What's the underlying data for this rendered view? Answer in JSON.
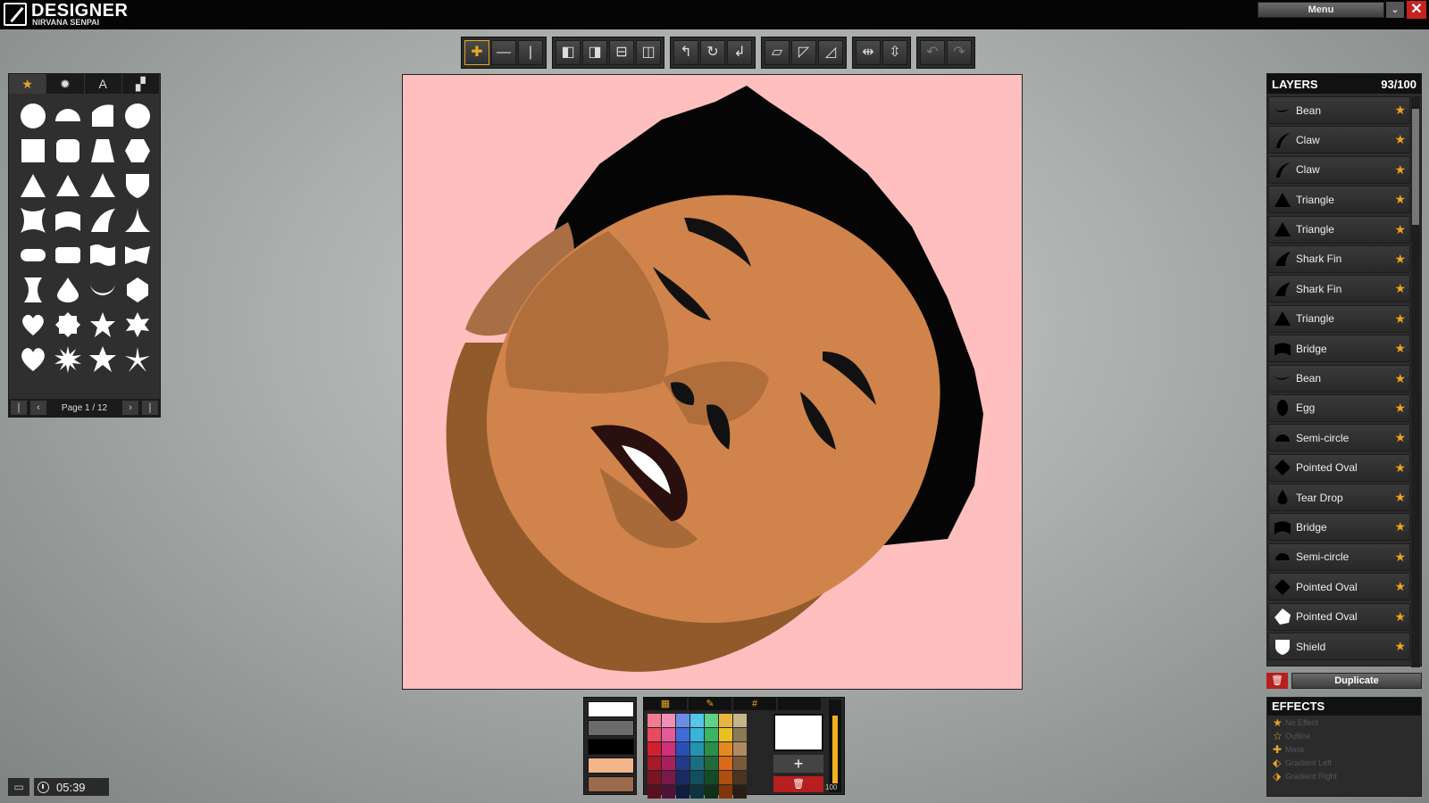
{
  "app": {
    "title": "DESIGNER",
    "subtitle": "NIRVANA SENPAI"
  },
  "topbar": {
    "menu_label": "Menu",
    "arrow": "⌄",
    "close": "✕"
  },
  "toolbar": {
    "groups": [
      [
        "move-icon",
        "minus-icon",
        "vertical-icon"
      ],
      [
        "layer-front-icon",
        "layer-back-icon",
        "align-h-icon",
        "align-v-icon"
      ],
      [
        "rotate-ccw-icon",
        "rotate-icon",
        "rotate-cw-icon"
      ],
      [
        "skew-icon",
        "stretch-h-icon",
        "stretch-v-icon"
      ],
      [
        "flip-h-icon",
        "flip-v-icon"
      ],
      [
        "undo-icon",
        "redo-icon"
      ]
    ]
  },
  "shape_panel": {
    "tabs": [
      "★",
      "✹",
      "A",
      "▞"
    ],
    "page_label": "Page 1 / 12",
    "shapes": [
      "circle",
      "semi-circle",
      "quarter",
      "octagon",
      "square",
      "rounded-square",
      "trapezoid",
      "hexagon",
      "triangle",
      "triangle-2",
      "pointed-triangle",
      "shield",
      "concave-square",
      "bridge",
      "shark-fin",
      "sharp-triangle",
      "capsule",
      "rounded-rect",
      "wave-flag",
      "ribbon",
      "hourglass",
      "tear-drop",
      "crescent",
      "pointed-oval",
      "heart-simple",
      "flower",
      "star",
      "star-6",
      "heart",
      "burst",
      "star-5",
      "pinwheel"
    ]
  },
  "layers": {
    "title": "LAYERS",
    "count": "93/100",
    "items": [
      {
        "name": "Bean",
        "icon": "bean"
      },
      {
        "name": "Claw",
        "icon": "claw"
      },
      {
        "name": "Claw",
        "icon": "claw"
      },
      {
        "name": "Triangle",
        "icon": "triangle"
      },
      {
        "name": "Triangle",
        "icon": "triangle"
      },
      {
        "name": "Shark Fin",
        "icon": "fin"
      },
      {
        "name": "Shark Fin",
        "icon": "fin"
      },
      {
        "name": "Triangle",
        "icon": "triangle"
      },
      {
        "name": "Bridge",
        "icon": "bridge"
      },
      {
        "name": "Bean",
        "icon": "bean"
      },
      {
        "name": "Egg",
        "icon": "egg"
      },
      {
        "name": "Semi-circle",
        "icon": "semi"
      },
      {
        "name": "Pointed Oval",
        "icon": "oval"
      },
      {
        "name": "Tear Drop",
        "icon": "drop"
      },
      {
        "name": "Bridge",
        "icon": "bridge"
      },
      {
        "name": "Semi-circle",
        "icon": "semi"
      },
      {
        "name": "Pointed Oval",
        "icon": "oval"
      },
      {
        "name": "Pointed Oval",
        "icon": "oval-white"
      },
      {
        "name": "Shield",
        "icon": "shield-white"
      }
    ],
    "duplicate_label": "Duplicate"
  },
  "effects": {
    "title": "EFFECTS",
    "items": [
      "No Effect",
      "Outline",
      "Mask",
      "Gradient Left",
      "Gradient Right"
    ]
  },
  "palette": {
    "swatches": [
      "#ffffff",
      "#6b6b6b",
      "#000000",
      "#f3b58a",
      "#9a6a4a"
    ],
    "slider_value": "100",
    "colors": [
      "#f17c8e",
      "#ef8fb6",
      "#6a8de8",
      "#54c7e8",
      "#5ed28a",
      "#e9b540",
      "#c4b68a",
      "#e94a5e",
      "#e45b9a",
      "#3f6bd8",
      "#38b5d8",
      "#3cb463",
      "#e8c020",
      "#8a7a55",
      "#d32030",
      "#d0307a",
      "#2b4fb8",
      "#2493b0",
      "#2a8f4a",
      "#e38a20",
      "#b08a60",
      "#a81a28",
      "#a8205e",
      "#233a8a",
      "#1b6e82",
      "#1f6a38",
      "#d86a18",
      "#7a5a3c",
      "#7a1420",
      "#7a1848",
      "#182a60",
      "#124e5c",
      "#154a28",
      "#b04e10",
      "#4a3422",
      "#581020",
      "#501238",
      "#101c40",
      "#0c3440",
      "#0e3219",
      "#803808",
      "#2a1e14"
    ],
    "add": "+",
    "delete": "🗑"
  },
  "status": {
    "timer": "05:39",
    "chat": "▭"
  }
}
